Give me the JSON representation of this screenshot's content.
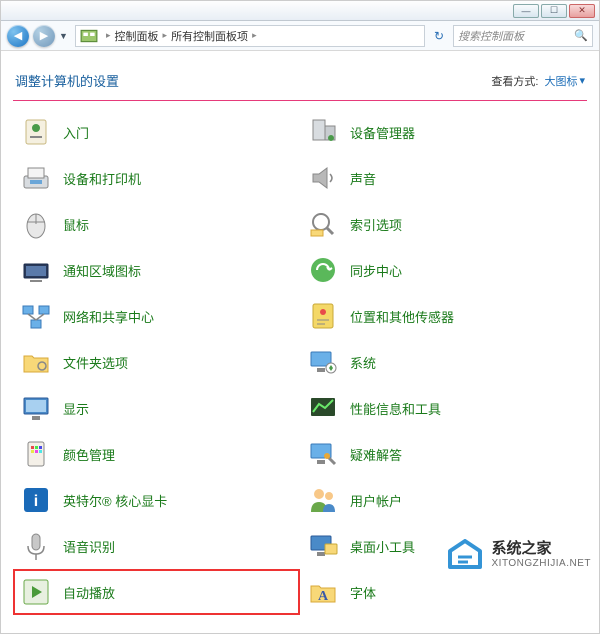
{
  "window": {
    "min": "—",
    "max": "☐",
    "close": "✕"
  },
  "nav": {
    "back": "◀",
    "fwd": "▶",
    "dd": "▼",
    "bc_root": "▸",
    "bc1": "控制面板",
    "bc2": "所有控制面板项",
    "refresh": "↻",
    "search_placeholder": "搜索控制面板",
    "mag": "🔍"
  },
  "header": {
    "title": "调整计算机的设置",
    "viewlabel": "查看方式:",
    "viewlink": "大图标",
    "dd": "▾"
  },
  "items_left": [
    {
      "id": "getting-started",
      "label": "入门"
    },
    {
      "id": "devices-printers",
      "label": "设备和打印机"
    },
    {
      "id": "mouse",
      "label": "鼠标"
    },
    {
      "id": "notification-icons",
      "label": "通知区域图标"
    },
    {
      "id": "network-sharing",
      "label": "网络和共享中心"
    },
    {
      "id": "folder-options",
      "label": "文件夹选项"
    },
    {
      "id": "display",
      "label": "显示"
    },
    {
      "id": "color-mgmt",
      "label": "颜色管理"
    },
    {
      "id": "intel-graphics",
      "label": "英特尔® 核心显卡"
    },
    {
      "id": "speech",
      "label": "语音识别"
    },
    {
      "id": "autoplay",
      "label": "自动播放",
      "highlight": true
    }
  ],
  "items_right": [
    {
      "id": "device-manager",
      "label": "设备管理器"
    },
    {
      "id": "sound",
      "label": "声音"
    },
    {
      "id": "indexing",
      "label": "索引选项"
    },
    {
      "id": "sync-center",
      "label": "同步中心"
    },
    {
      "id": "location-sensors",
      "label": "位置和其他传感器"
    },
    {
      "id": "system",
      "label": "系统"
    },
    {
      "id": "performance",
      "label": "性能信息和工具"
    },
    {
      "id": "troubleshoot",
      "label": "疑难解答"
    },
    {
      "id": "user-accounts",
      "label": "用户帐户"
    },
    {
      "id": "gadgets",
      "label": "桌面小工具"
    },
    {
      "id": "fonts",
      "label": "字体"
    }
  ],
  "watermark": {
    "main": "系统之家",
    "sub": "XITONGZHIJIA.NET"
  }
}
